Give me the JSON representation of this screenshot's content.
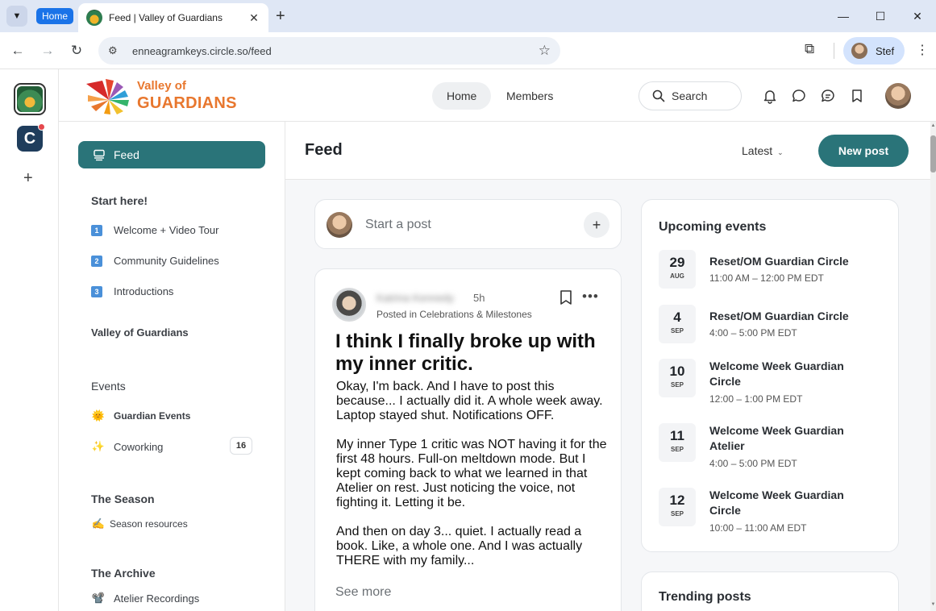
{
  "browser": {
    "group_label": "Home",
    "tab_title": "Feed | Valley of Guardians",
    "url": "enneagramkeys.circle.so/feed",
    "profile_name": "Stef"
  },
  "brand": {
    "line1": "Valley of",
    "line2": "GUARDIANS"
  },
  "header": {
    "nav": [
      {
        "label": "Home",
        "active": true
      },
      {
        "label": "Members",
        "active": false
      }
    ],
    "search_label": "Search"
  },
  "sidebar": {
    "feed_label": "Feed",
    "sections": {
      "start_here": {
        "title": "Start here!",
        "items": [
          {
            "badge": "1",
            "label": "Welcome + Video Tour"
          },
          {
            "badge": "2",
            "label": "Community Guidelines"
          },
          {
            "badge": "3",
            "label": "Introductions"
          }
        ]
      },
      "valley": {
        "title": "Valley of Guardians"
      },
      "events": {
        "title": "Events",
        "items": [
          {
            "emoji": "🌞",
            "label": "Guardian Events"
          },
          {
            "emoji": "✨",
            "label": "Coworking",
            "count": "16"
          }
        ]
      },
      "season": {
        "title": "The Season",
        "items": [
          {
            "emoji": "✍️",
            "label": "Season resources"
          }
        ]
      },
      "archive": {
        "title": "The Archive",
        "items": [
          {
            "emoji": "📽️",
            "label": "Atelier Recordings"
          }
        ]
      }
    }
  },
  "main": {
    "title": "Feed",
    "sort_label": "Latest",
    "new_post_label": "New post",
    "composer_placeholder": "Start a post",
    "post": {
      "author": "Katrina Kennedy",
      "time": "5h",
      "meta": "Posted in Celebrations & Milestones",
      "title": "I think I finally broke up with my inner critic.",
      "body": "Okay, I'm back. And I have to post this because... I actually did it. A whole week away. Laptop stayed shut. Notifications OFF.\n\nMy inner Type 1 critic was NOT having it for the first 48 hours. Full-on meltdown mode. But I kept coming back to what we learned in that Atelier on rest. Just noticing the voice, not fighting it. Letting it be.\n\nAnd then on day 3... quiet. I actually read a book. Like, a whole one. And I was actually THERE with my family...",
      "see_more": "See more"
    }
  },
  "events": {
    "title": "Upcoming events",
    "items": [
      {
        "day": "29",
        "month": "AUG",
        "name": "Reset/OM Guardian Circle",
        "time": "11:00 AM – 12:00 PM EDT"
      },
      {
        "day": "4",
        "month": "SEP",
        "name": "Reset/OM Guardian Circle",
        "time": "4:00 – 5:00 PM EDT"
      },
      {
        "day": "10",
        "month": "SEP",
        "name": "Welcome Week Guardian Circle",
        "time": "12:00 – 1:00 PM EDT"
      },
      {
        "day": "11",
        "month": "SEP",
        "name": "Welcome Week Guardian Atelier",
        "time": "4:00 – 5:00 PM EDT"
      },
      {
        "day": "12",
        "month": "SEP",
        "name": "Welcome Week Guardian Circle",
        "time": "10:00 – 11:00 AM EDT"
      }
    ]
  },
  "trending": {
    "title": "Trending posts"
  },
  "colors": {
    "accent": "#2a7479",
    "brand_orange": "#e8772e",
    "chrome_blue": "#1a73e8"
  }
}
